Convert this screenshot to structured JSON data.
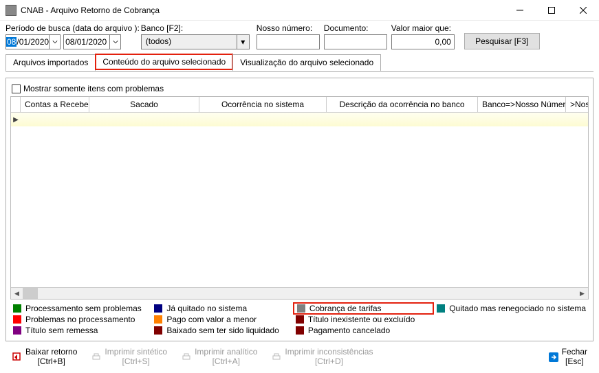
{
  "window": {
    "title": "CNAB - Arquivo Retorno de Cobrança"
  },
  "filters": {
    "periodo_label": "Período de busca (data do arquivo ):",
    "date_from": "08/01/2020",
    "date_from_sel": "08",
    "date_from_rest": "/01/2020",
    "date_to": "08/01/2020",
    "banco_label": "Banco [F2]:",
    "banco_value": "(todos)",
    "nosso_numero_label": "Nosso número:",
    "nosso_numero_value": "",
    "documento_label": "Documento:",
    "documento_value": "",
    "valor_label": "Valor maior que:",
    "valor_value": "0,00",
    "pesquisar_label": "Pesquisar [F3]"
  },
  "tabs": {
    "t1": "Arquivos importados",
    "t2": "Conteúdo do arquivo selecionado",
    "t3": "Visualização do arquivo selecionado"
  },
  "content": {
    "chk_label": "Mostrar somente itens com problemas",
    "columns": {
      "c1": "Contas a Receber",
      "c2": "Sacado",
      "c3": "Ocorrência no sistema",
      "c4": "Descrição da ocorrência no banco",
      "c5": "Banco=>Nosso Número",
      "c6": ">Nosso"
    }
  },
  "legend": {
    "l1": "Processamento sem problemas",
    "l2": "Já quitado no sistema",
    "l3": "Cobrança de tarifas",
    "l4": "Quitado mas renegociado no sistema",
    "l5": "Problemas no processamento",
    "l6": "Pago com valor a menor",
    "l7": "Título inexistente ou excluído",
    "l8": "Título sem remessa",
    "l9": "Baixado sem ter sido liquidado",
    "l10": "Pagamento cancelado"
  },
  "footer": {
    "b1_l1": "Baixar retorno",
    "b1_l2": "[Ctrl+B]",
    "b2_l1": "Imprimir sintético",
    "b2_l2": "[Ctrl+S]",
    "b3_l1": "Imprimir analítico",
    "b3_l2": "[Ctrl+A]",
    "b4_l1": "Imprimir inconsistências",
    "b4_l2": "[Ctrl+D]",
    "b5_l1": "Fechar",
    "b5_l2": "[Esc]"
  }
}
